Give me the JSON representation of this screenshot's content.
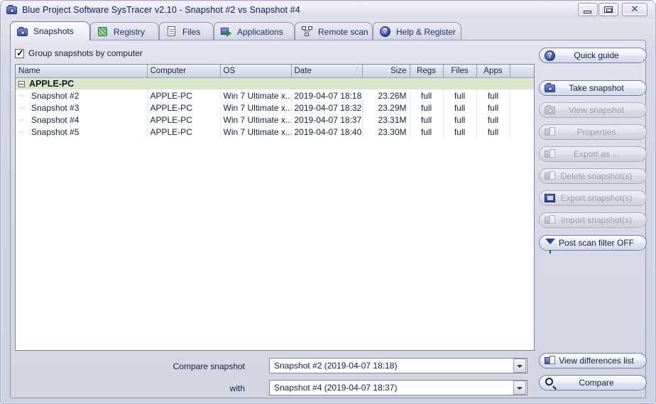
{
  "window": {
    "title": "Blue Project Software SysTracer v2.10 - Snapshot #2 vs Snapshot #4",
    "icon": "camera-icon",
    "controls": {
      "minimize": "minimize-icon",
      "maximize": "maximize-icon",
      "close": "close-icon"
    }
  },
  "tabs": [
    {
      "label": "Snapshots",
      "icon": "camera-icon",
      "active": true
    },
    {
      "label": "Registry",
      "icon": "registry-icon",
      "active": false
    },
    {
      "label": "Files",
      "icon": "file-icon",
      "active": false
    },
    {
      "label": "Applications",
      "icon": "application-icon",
      "active": false
    },
    {
      "label": "Remote scan",
      "icon": "network-icon",
      "active": false
    },
    {
      "label": "Help & Register",
      "icon": "help-icon",
      "active": false
    }
  ],
  "options": {
    "group_snapshots_label": "Group snapshots by computer",
    "group_snapshots_checked": true
  },
  "table": {
    "columns": [
      "Name",
      "Computer",
      "OS",
      "Date",
      "Size",
      "Regs",
      "Files",
      "Apps"
    ],
    "sort_column": "Date",
    "sort_indicator": "/",
    "group": {
      "label": "APPLE-PC",
      "expanded": true
    },
    "rows": [
      {
        "name": "Snapshot #2",
        "computer": "APPLE-PC",
        "os": "Win 7 Ultimate x...",
        "date": "2019-04-07 18:18",
        "size": "23.26M",
        "regs": "full",
        "files": "full",
        "apps": "full"
      },
      {
        "name": "Snapshot #3",
        "computer": "APPLE-PC",
        "os": "Win 7 Ultimate x...",
        "date": "2019-04-07 18:32",
        "size": "23.29M",
        "regs": "full",
        "files": "full",
        "apps": "full"
      },
      {
        "name": "Snapshot #4",
        "computer": "APPLE-PC",
        "os": "Win 7 Ultimate x...",
        "date": "2019-04-07 18:37",
        "size": "23.31M",
        "regs": "full",
        "files": "full",
        "apps": "full"
      },
      {
        "name": "Snapshot #5",
        "computer": "APPLE-PC",
        "os": "Win 7 Ultimate x...",
        "date": "2019-04-07 18:40",
        "size": "23.30M",
        "regs": "full",
        "files": "full",
        "apps": "full"
      }
    ]
  },
  "compare": {
    "label_first": "Compare snapshot",
    "label_second": "with",
    "value_first": "Snapshot #2 (2019-04-07 18:18)",
    "value_second": "Snapshot #4 (2019-04-07 18:37)"
  },
  "side_buttons": [
    {
      "label": "Quick guide",
      "icon": "help-icon",
      "enabled": true
    },
    {
      "label": "Take snapshot",
      "icon": "camera-icon",
      "enabled": true
    },
    {
      "label": "View snapshot",
      "icon": "camera-view-icon",
      "enabled": false
    },
    {
      "label": "Properties",
      "icon": "properties-icon",
      "enabled": false
    },
    {
      "label": "Export as ...",
      "icon": "export-icon",
      "enabled": false
    },
    {
      "label": "Delete snapshot(s)",
      "icon": "delete-icon",
      "enabled": false
    },
    {
      "label": "Export snapshot(s)",
      "icon": "export-file-icon",
      "enabled": false
    },
    {
      "label": "Import snapshot(s)",
      "icon": "import-icon",
      "enabled": false
    },
    {
      "label": "Post scan filter OFF",
      "icon": "funnel-icon",
      "enabled": true
    }
  ],
  "bottom_buttons": [
    {
      "label": "View differences list",
      "icon": "differences-icon",
      "enabled": true
    },
    {
      "label": "Compare",
      "icon": "magnifier-icon",
      "enabled": true
    }
  ],
  "colors": {
    "group_row": "#d9e6c8",
    "panel": "#d8dbe7",
    "accent": "#2d3f96"
  }
}
